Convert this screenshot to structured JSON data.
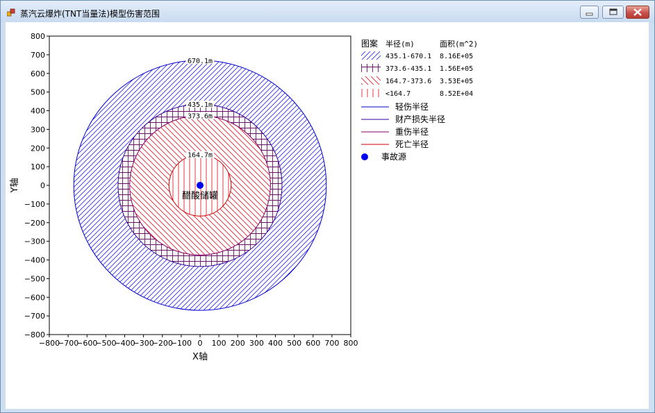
{
  "window": {
    "title": "蒸汽云爆炸(TNT当量法)模型伤害范围"
  },
  "chart_data": {
    "type": "scatter",
    "xlabel": "X轴",
    "ylabel": "Y轴",
    "xlim": [
      -800,
      800
    ],
    "ylim": [
      -800,
      800
    ],
    "tick_step": 100,
    "circles": [
      {
        "name": "轻伤半径",
        "radius": 670.1,
        "label": "670.1m",
        "color": "#0000cc"
      },
      {
        "name": "财产损失半径",
        "radius": 435.1,
        "label": "435.1m",
        "color": "#330099"
      },
      {
        "name": "重伤半径",
        "radius": 373.6,
        "label": "373.6m",
        "color": "#880066"
      },
      {
        "name": "死亡半径",
        "radius": 164.7,
        "label": "164.7m",
        "color": "#cc0000"
      }
    ],
    "source": {
      "name": "事故源",
      "label": "醋酸储罐",
      "x": 0,
      "y": 0,
      "color": "#0000ee"
    },
    "legend": {
      "header": [
        "图案",
        "半径(m)",
        "面积(m^2)"
      ],
      "areas": [
        {
          "range": "435.1-670.1",
          "area": "8.16E+05",
          "color": "#3333ee",
          "pattern": "diag-up"
        },
        {
          "range": "373.6-435.1",
          "area": "1.56E+05",
          "color": "#661166",
          "pattern": "grid"
        },
        {
          "range": "164.7-373.6",
          "area": "3.53E+05",
          "color": "#dd2233",
          "pattern": "diag-down"
        },
        {
          "range": "<164.7",
          "area": "8.52E+04",
          "color": "#dd2233",
          "pattern": "vertical"
        }
      ],
      "lines": [
        {
          "label": "轻伤半径",
          "color": "#0000cc"
        },
        {
          "label": "财产损失半径",
          "color": "#330099"
        },
        {
          "label": "重伤半径",
          "color": "#880066"
        },
        {
          "label": "死亡半径",
          "color": "#cc0000"
        }
      ],
      "marker": {
        "label": "事故源",
        "color": "#0000ee"
      }
    }
  }
}
